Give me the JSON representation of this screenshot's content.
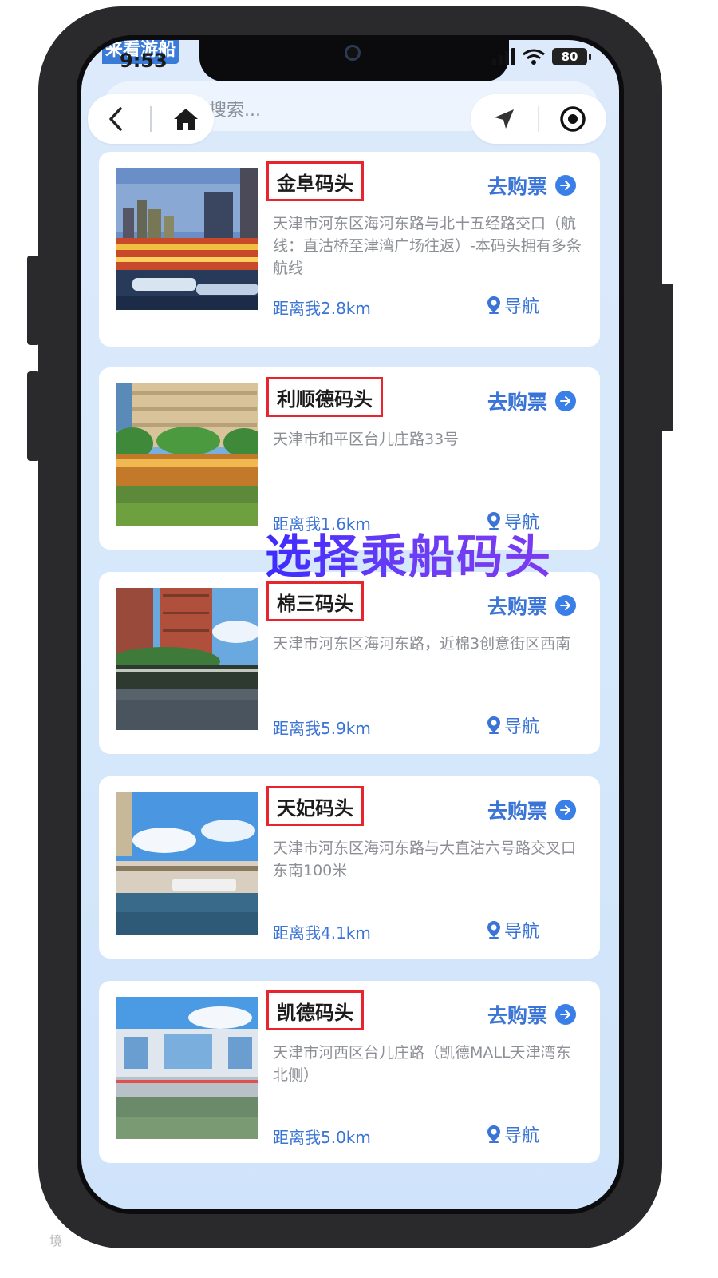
{
  "status_bar": {
    "app_tag": "来看游船",
    "time": "9:53",
    "battery": "80"
  },
  "search": {
    "placeholder": "搜索..."
  },
  "piers": [
    {
      "name": "金阜码头",
      "buy_label": "去购票",
      "address": "天津市河东区海河东路与北十五经路交口（航线：直沽桥至津湾广场往返）-本码头拥有多条航线",
      "distance": "距离我2.8km",
      "nav_label": "导航"
    },
    {
      "name": "利顺德码头",
      "buy_label": "去购票",
      "address": "天津市和平区台儿庄路33号",
      "distance": "距离我1.6km",
      "nav_label": "导航"
    },
    {
      "name": "棉三码头",
      "buy_label": "去购票",
      "address": "天津市河东区海河东路，近棉3创意街区西南",
      "distance": "距离我5.9km",
      "nav_label": "导航"
    },
    {
      "name": "天妃码头",
      "buy_label": "去购票",
      "address": "天津市河东区海河东路与大直沽六号路交叉口东南100米",
      "distance": "距离我4.1km",
      "nav_label": "导航"
    },
    {
      "name": "凯德码头",
      "buy_label": "去购票",
      "address": "天津市河西区台儿庄路（凯德MALL天津湾东北侧）",
      "distance": "距离我5.0km",
      "nav_label": "导航"
    }
  ],
  "overlay_caption": "选择乘船码头",
  "watermark": "境",
  "colors": {
    "accent": "#3a74d6",
    "highlight_box": "#e8252e",
    "caption": "#5a35f5"
  }
}
